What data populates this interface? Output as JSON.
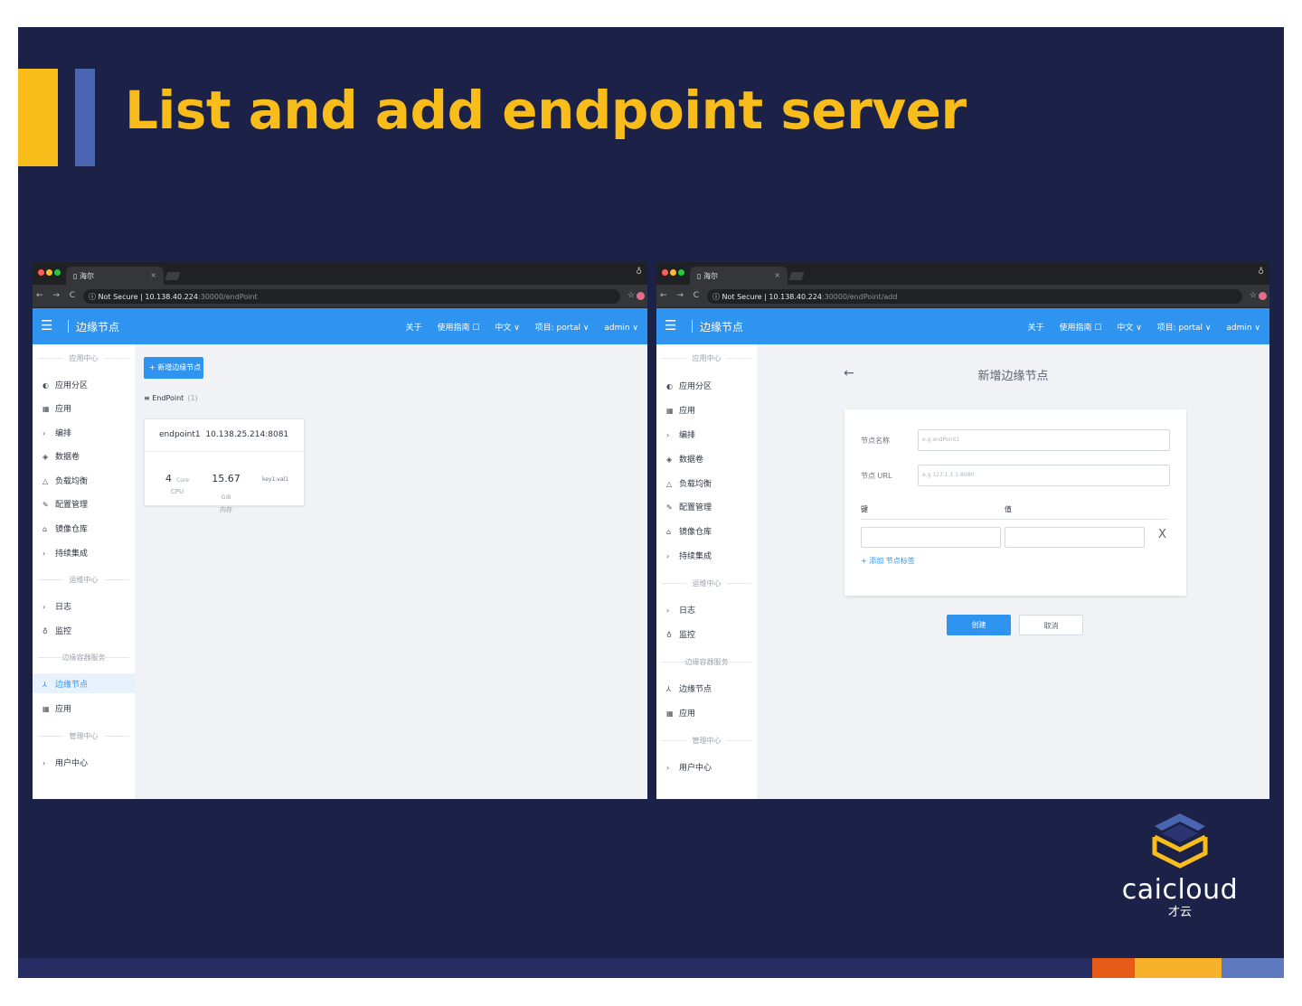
{
  "slide": {
    "title": "List and add endpoint server",
    "logo": {
      "brand": "caicloud",
      "sub": "才云"
    },
    "colors": {
      "background": "#1c2147",
      "accent_yellow": "#f9bd1b",
      "accent_blue": "#4a65b1",
      "app_blue": "#2f93f0"
    }
  },
  "left_window": {
    "browser": {
      "tab_title": "海尔",
      "tab_close": "×",
      "nav_icons": "← → C ⌂",
      "security": "ⓘ Not Secure",
      "url_host": "10.138.40.224",
      "url_path": ":30000/endPoint"
    },
    "header": {
      "title": "边缘节点",
      "menu_icon": "menu-icon",
      "links": [
        "关于",
        "使用指南 ☐",
        "中文 ∨",
        "项目: portal ∨",
        "admin ∨"
      ]
    },
    "sidebar": {
      "groups": [
        "应用中心",
        "运维中心",
        "边缘容器服务",
        "管理中心"
      ],
      "items": [
        {
          "icon": "◐",
          "label": "应用分区"
        },
        {
          "icon": "▦",
          "label": "应用"
        },
        {
          "icon": "›",
          "label": "编排"
        },
        {
          "icon": "◈",
          "label": "数据卷"
        },
        {
          "icon": "△",
          "label": "负载均衡"
        },
        {
          "icon": "✎",
          "label": "配置管理"
        },
        {
          "icon": "⌂",
          "label": "镜像仓库"
        },
        {
          "icon": "›",
          "label": "持续集成"
        },
        {
          "icon": "›",
          "label": "日志"
        },
        {
          "icon": "♁",
          "label": "监控"
        },
        {
          "icon": "⅄",
          "label": "边缘节点"
        },
        {
          "icon": "▦",
          "label": "应用"
        },
        {
          "icon": "›",
          "label": "用户中心"
        }
      ]
    },
    "main": {
      "add_button": "+ 新增边缘节点",
      "list_icon": "≡",
      "list_title": "EndPoint",
      "list_count": "(1)",
      "card": {
        "name": "endpoint1",
        "address": "10.138.25.214:8081",
        "cpu_value": "4",
        "cpu_unit": "Core",
        "cpu_label": "CPU",
        "mem_value": "15.67",
        "mem_unit": "GiB",
        "mem_label": "内存",
        "label_kv": "key1:val1"
      }
    }
  },
  "right_window": {
    "browser": {
      "tab_title": "海尔",
      "tab_close": "×",
      "nav_icons": "← → C ⌂",
      "security": "ⓘ Not Secure",
      "url_host": "10.138.40.224",
      "url_path": ":30000/endPoint/add"
    },
    "header": {
      "title": "边缘节点",
      "menu_icon": "menu-icon",
      "links": [
        "关于",
        "使用指南 ☐",
        "中文 ∨",
        "项目: portal ∨",
        "admin ∨"
      ]
    },
    "sidebar": {
      "groups": [
        "应用中心",
        "运维中心",
        "边缘容器服务",
        "管理中心"
      ],
      "items": [
        {
          "icon": "◐",
          "label": "应用分区"
        },
        {
          "icon": "▦",
          "label": "应用"
        },
        {
          "icon": "›",
          "label": "编排"
        },
        {
          "icon": "◈",
          "label": "数据卷"
        },
        {
          "icon": "△",
          "label": "负载均衡"
        },
        {
          "icon": "✎",
          "label": "配置管理"
        },
        {
          "icon": "⌂",
          "label": "镜像仓库"
        },
        {
          "icon": "›",
          "label": "持续集成"
        },
        {
          "icon": "›",
          "label": "日志"
        },
        {
          "icon": "♁",
          "label": "监控"
        },
        {
          "icon": "⅄",
          "label": "边缘节点"
        },
        {
          "icon": "▦",
          "label": "应用"
        },
        {
          "icon": "›",
          "label": "用户中心"
        }
      ]
    },
    "form": {
      "back": "←",
      "title": "新增边缘节点",
      "name_label": "节点名称",
      "name_placeholder": "e.g endPoint1",
      "url_label": "节点 URL",
      "url_placeholder": "e.g 127.1.1.1:8080",
      "key_header": "键",
      "value_header": "值",
      "remove": "X",
      "add_tag": "+ 添加 节点标签",
      "create_button": "创建",
      "cancel_button": "取消"
    }
  }
}
